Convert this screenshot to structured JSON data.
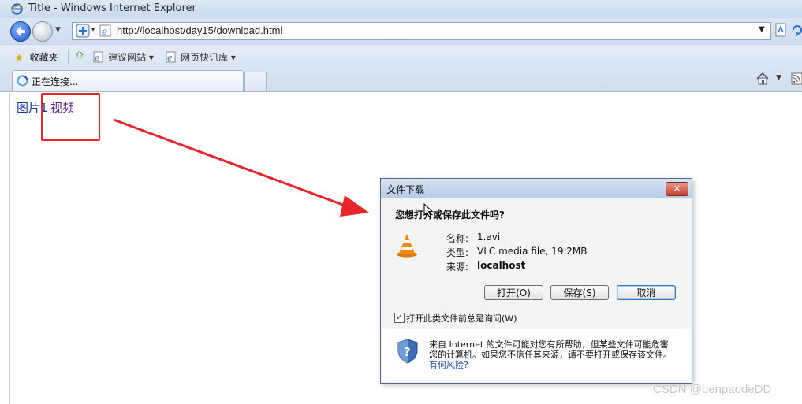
{
  "window": {
    "title": "Title - Windows Internet Explorer",
    "url": "http://localhost/day15/download.html"
  },
  "favorites_bar": {
    "favorites_label": "收藏夹",
    "items": [
      "建议网站 ▾",
      "网页快讯库 ▾"
    ]
  },
  "tab": {
    "label": "正在连接..."
  },
  "page": {
    "links": [
      "图片1",
      "视频"
    ]
  },
  "dialog": {
    "title": "文件下载",
    "close_label": "✕",
    "question": "您想打开或保存此文件吗?",
    "fields": {
      "name_label": "名称:",
      "name_value": "1.avi",
      "type_label": "类型:",
      "type_value": "VLC media file, 19.2MB",
      "source_label": "来源:",
      "source_value": "localhost"
    },
    "buttons": {
      "open": "打开(O)",
      "save": "保存(S)",
      "cancel": "取消"
    },
    "checkbox_label": "打开此类文件前总是询问(W)",
    "warning_text": "来自 Internet 的文件可能对您有所帮助，但某些文件可能危害您的计算机。如果您不信任其来源，请不要打开或保存该文件。",
    "risk_link": "有何风险?"
  },
  "watermark": "CSDN @benpaodeDD",
  "colors": {
    "annotation_red": "#e7252a",
    "link_blue": "#1a37a8"
  }
}
